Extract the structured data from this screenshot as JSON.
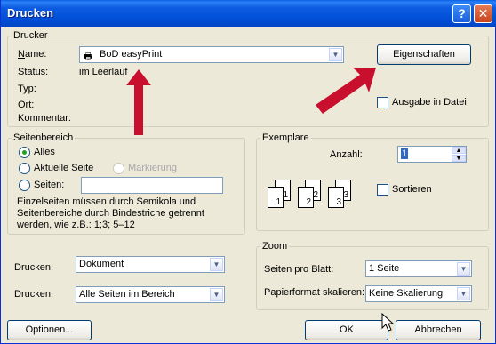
{
  "window": {
    "title": "Drucken",
    "help_glyph": "?",
    "close_glyph": "✕"
  },
  "printer": {
    "legend": "Drucker",
    "name_label": "Name:",
    "name_value": "BoD easyPrint",
    "status_label": "Status:",
    "status_value": "im Leerlauf",
    "type_label": "Typ:",
    "location_label": "Ort:",
    "comment_label": "Kommentar:",
    "properties_button": "Eigenschaften",
    "print_to_file_label": "Ausgabe in Datei",
    "print_to_file_checked": false
  },
  "page_range": {
    "legend": "Seitenbereich",
    "all_label": "Alles",
    "current_label": "Aktuelle Seite",
    "selection_label": "Markierung",
    "pages_label": "Seiten:",
    "pages_value": "",
    "selected": "all",
    "hint": "Einzelseiten müssen durch Semikola und Seitenbereiche durch Bindestriche getrennt werden, wie z.B.: 1;3; 5–12"
  },
  "copies": {
    "legend": "Exemplare",
    "count_label": "Anzahl:",
    "count_value": "1",
    "collate_label": "Sortieren",
    "collate_checked": false,
    "page_numbers": [
      "1",
      "1",
      "2",
      "2",
      "3",
      "3"
    ]
  },
  "print_what": {
    "label": "Drucken:",
    "value": "Dokument"
  },
  "print_range": {
    "label": "Drucken:",
    "value": "Alle Seiten im Bereich"
  },
  "zoom": {
    "legend": "Zoom",
    "pages_per_sheet_label": "Seiten pro Blatt:",
    "pages_per_sheet_value": "1 Seite",
    "scale_label": "Papierformat skalieren:",
    "scale_value": "Keine Skalierung"
  },
  "buttons": {
    "options": "Optionen...",
    "ok": "OK",
    "cancel": "Abbrechen"
  },
  "colors": {
    "annotation_arrow": "#c8102e",
    "titlebar": "#0250d8"
  }
}
